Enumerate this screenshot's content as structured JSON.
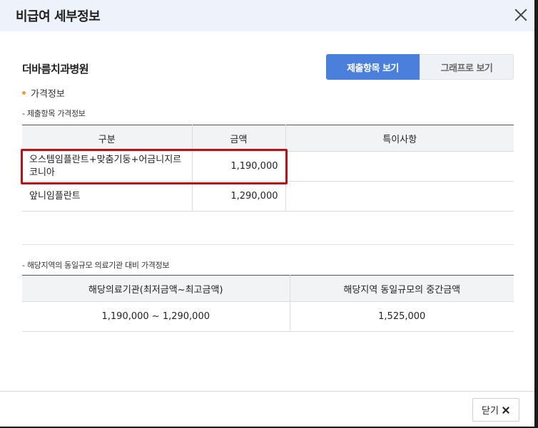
{
  "modal": {
    "title": "비급여 세부정보"
  },
  "hospital": {
    "name": "더바름치과병원"
  },
  "view_toggle": {
    "items_label": "제출항목 보기",
    "graph_label": "그래프로 보기",
    "active": "items"
  },
  "section": {
    "price_info_label": "가격정보",
    "submitted_heading": "- 제출항목 가격정보",
    "regional_heading": "- 해당지역의 동일규모 의료기관 대비 가격정보"
  },
  "submitted_table": {
    "headers": [
      "구분",
      "금액",
      "특이사항"
    ],
    "rows": [
      {
        "category": "오스템임플란트+맞춤기둥+어금니지르코니아",
        "amount": "1,190,000",
        "note": "",
        "highlighted": true
      },
      {
        "category": "앞니임플란트",
        "amount": "1,290,000",
        "note": "",
        "highlighted": false
      }
    ]
  },
  "regional_table": {
    "headers": [
      "해당의료기관(최저금액~최고금액)",
      "해당지역 동일규모의 중간금액"
    ],
    "rows": [
      {
        "range": "1,190,000 ~ 1,290,000",
        "median": "1,525,000"
      }
    ]
  },
  "footer": {
    "close_label": "닫기"
  },
  "colors": {
    "accent": "#4a7fdc",
    "header_bg": "#eef2fb",
    "highlight": "#b5121b",
    "bullet": "#f0a030"
  },
  "icons": {
    "close": "close-icon",
    "bullet": "bullet-dot-icon"
  }
}
